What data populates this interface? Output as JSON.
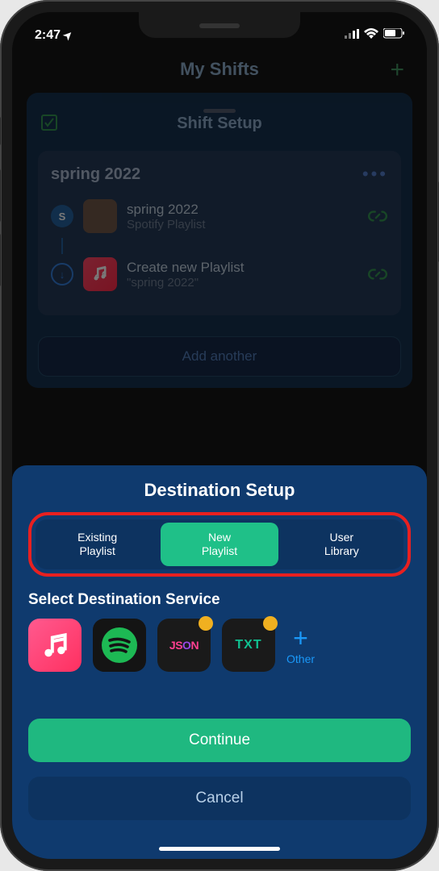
{
  "status": {
    "time": "2:47",
    "location_arrow": "➤"
  },
  "header": {
    "title": "My Shifts",
    "plus": "+"
  },
  "sheet_top": {
    "title": "Shift Setup"
  },
  "shift": {
    "name": "spring 2022",
    "source": {
      "primary": "spring 2022",
      "secondary": "Spotify Playlist",
      "badge": "S"
    },
    "dest": {
      "primary": "Create new Playlist",
      "secondary": "\"spring 2022\"",
      "arrow": "↓"
    },
    "dots": "•••"
  },
  "add_another": "Add another",
  "dest_setup": {
    "title": "Destination Setup",
    "tabs": [
      {
        "line1": "Existing",
        "line2": "Playlist"
      },
      {
        "line1": "New",
        "line2": "Playlist"
      },
      {
        "line1": "User",
        "line2": "Library"
      }
    ],
    "select_label": "Select Destination Service",
    "services": {
      "json_j": "JS",
      "json_o": "O",
      "json_n": "N",
      "txt": "TXT"
    },
    "other_label": "Other",
    "other_plus": "+"
  },
  "actions": {
    "continue": "Continue",
    "cancel": "Cancel"
  }
}
